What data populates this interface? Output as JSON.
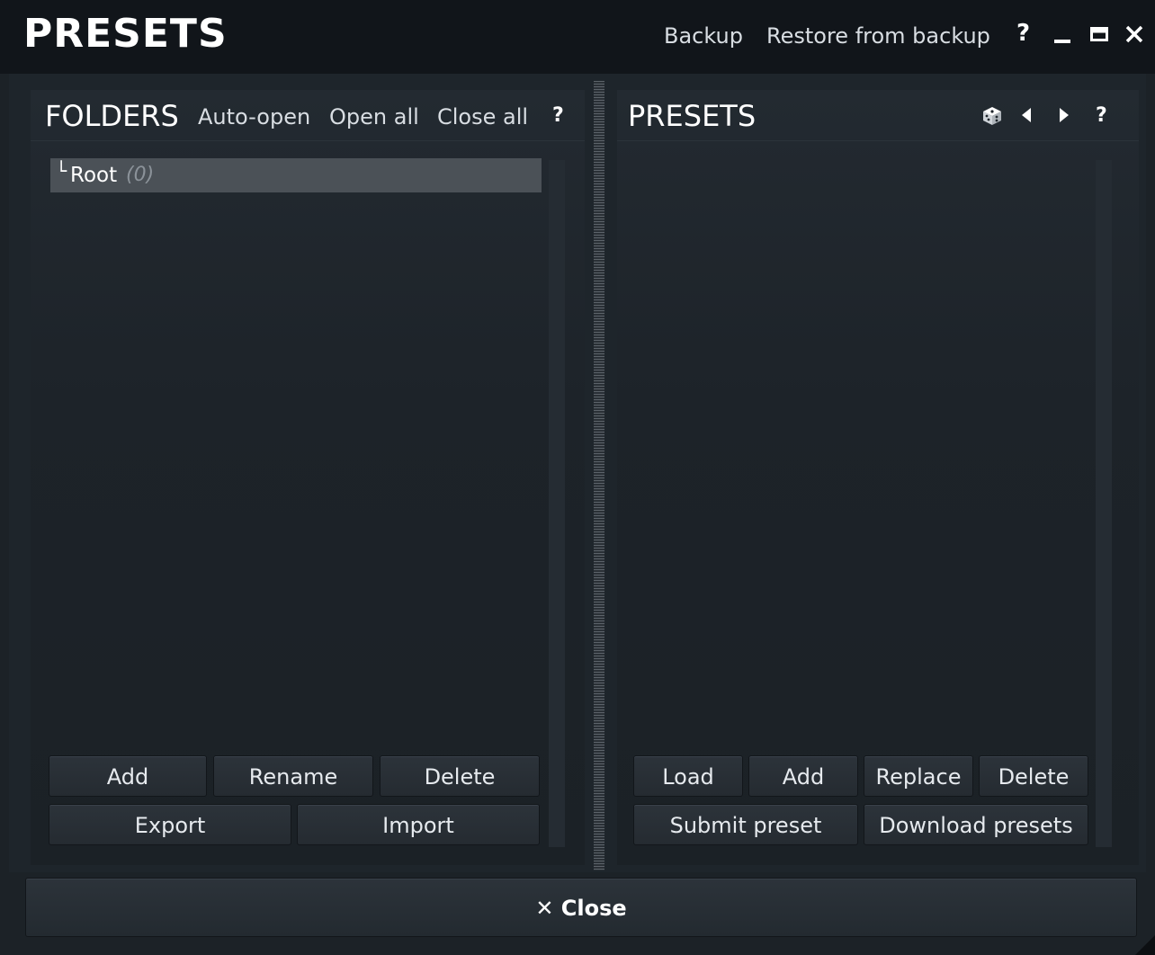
{
  "window": {
    "title": "PRESETS",
    "backup_label": "Backup",
    "restore_label": "Restore from backup",
    "help_label": "?",
    "minimize_label": "–",
    "maximize_label": "▭",
    "close_label": "✕"
  },
  "folders": {
    "title": "FOLDERS",
    "auto_open_label": "Auto-open",
    "open_all_label": "Open all",
    "close_all_label": "Close all",
    "help_label": "?",
    "tree": [
      {
        "connector": "└",
        "name": "Root",
        "count": "(0)"
      }
    ],
    "buttons": {
      "add": "Add",
      "rename": "Rename",
      "delete": "Delete",
      "export": "Export",
      "import": "Import"
    }
  },
  "presets": {
    "title": "PRESETS",
    "random_icon": "dice-icon",
    "prev_label": "◀",
    "next_label": "▶",
    "help_label": "?",
    "buttons": {
      "load": "Load",
      "add": "Add",
      "replace": "Replace",
      "delete": "Delete",
      "submit": "Submit preset",
      "download": "Download presets"
    }
  },
  "footer": {
    "close_label": "✕ Close"
  }
}
